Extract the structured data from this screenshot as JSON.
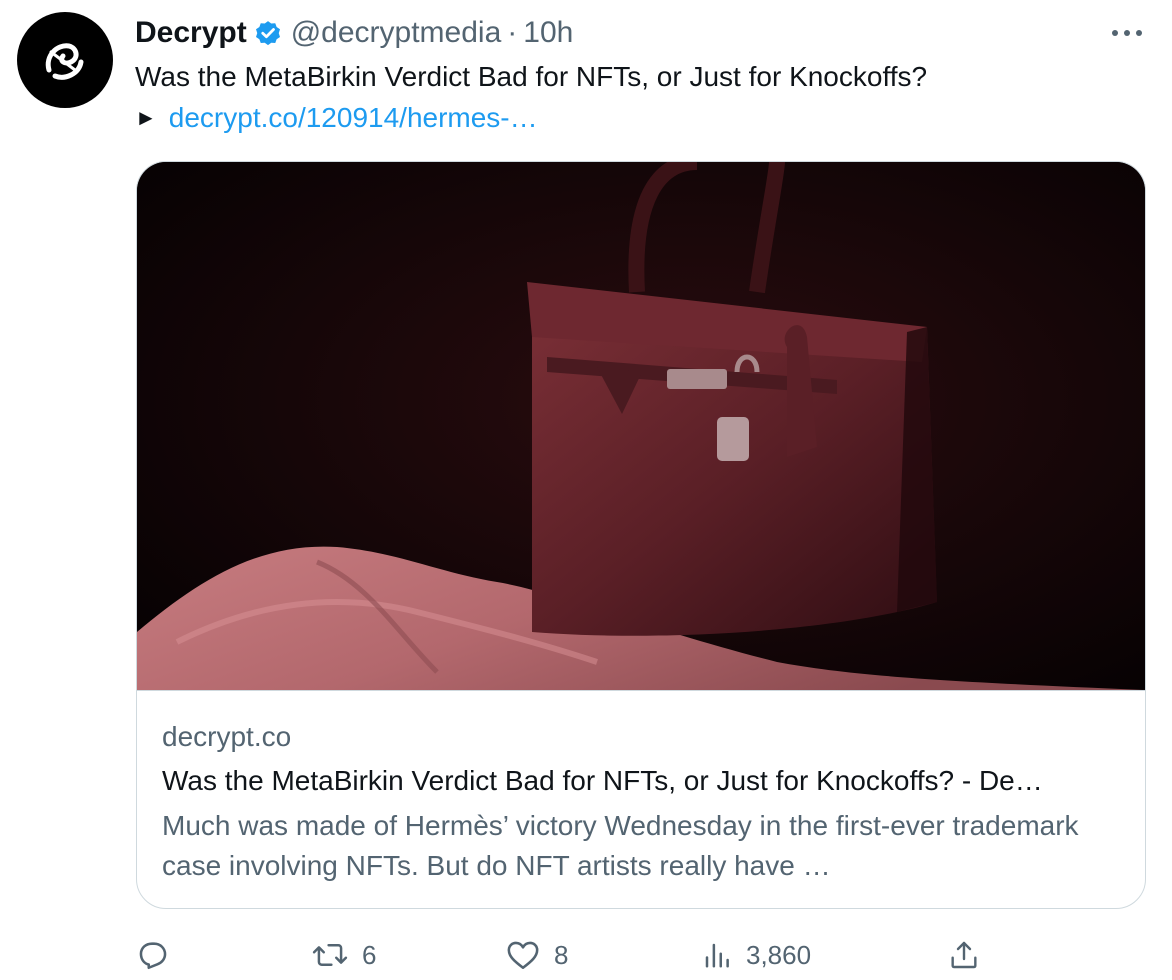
{
  "author": {
    "display_name": "Decrypt",
    "handle": "@decryptmedia",
    "separator": "·",
    "time": "10h",
    "avatar_icon": "decrypt-logo-icon",
    "verified_icon": "verified-badge-icon",
    "verified_color": "#1d9bf0"
  },
  "tweet": {
    "text": "Was the MetaBirkin Verdict Bad for NFTs, or Just for Knockoffs?",
    "link_prefix": "►",
    "link_text": "decrypt.co/120914/hermes-…"
  },
  "card": {
    "image_description_icon": "handbag-photo",
    "domain": "decrypt.co",
    "title": "Was the MetaBirkin Verdict Bad for NFTs, or Just for Knockoffs? - De…",
    "description": "Much was made of Hermès’ victory Wednesday in the first-ever trademark case involving NFTs. But do NFT artists really have …"
  },
  "actions": {
    "reply_icon": "reply-icon",
    "retweet_icon": "retweet-icon",
    "retweet_count": "6",
    "like_icon": "heart-icon",
    "like_count": "8",
    "views_icon": "views-chart-icon",
    "views_count": "3,860",
    "share_icon": "share-icon"
  },
  "colors": {
    "text_primary": "#0f1419",
    "text_secondary": "#536471",
    "link": "#1d9bf0",
    "border": "#cfd9de"
  }
}
